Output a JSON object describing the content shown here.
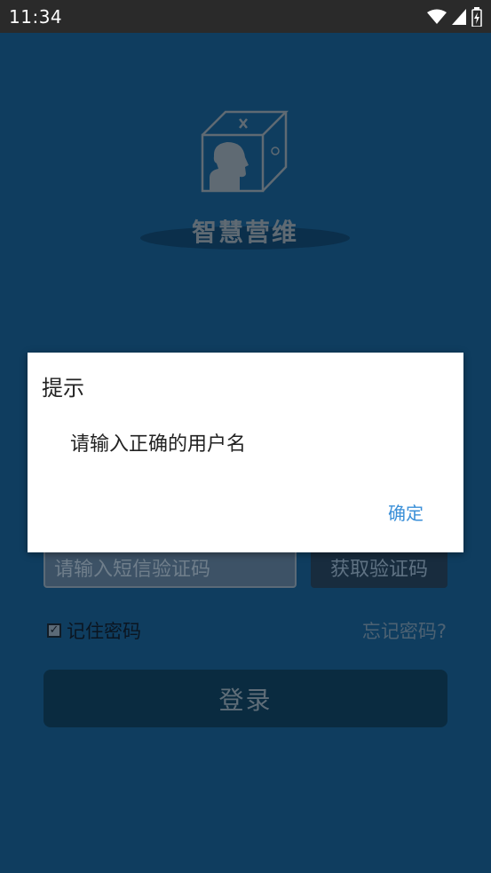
{
  "status_bar": {
    "time": "11:34",
    "icons": [
      "wifi-icon",
      "signal-icon",
      "battery-charging-icon"
    ]
  },
  "app": {
    "title": "智慧营维",
    "sms_code_placeholder": "请输入短信验证码",
    "get_code_label": "获取验证码",
    "remember_password_label": "记住密码",
    "remember_password_checked": true,
    "forgot_password_label": "忘记密码?",
    "login_label": "登录"
  },
  "dialog": {
    "title": "提示",
    "message": "请输入正确的用户名",
    "ok_label": "确定"
  },
  "colors": {
    "background": "#0f3d5f",
    "dialog_accent": "#3a8fd8"
  }
}
